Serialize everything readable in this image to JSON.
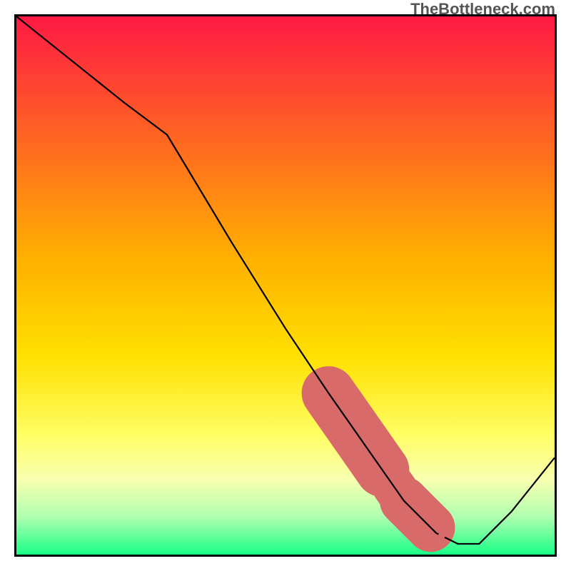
{
  "watermark": "TheBottleneck.com",
  "chart_data": {
    "type": "line",
    "title": "",
    "xlabel": "",
    "ylabel": "",
    "xlim": [
      0,
      100
    ],
    "ylim": [
      0,
      100
    ],
    "background_gradient": {
      "stops": [
        {
          "pos": 0.0,
          "color": "#ff1a44"
        },
        {
          "pos": 0.45,
          "color": "#ffb000"
        },
        {
          "pos": 0.63,
          "color": "#ffe000"
        },
        {
          "pos": 0.78,
          "color": "#ffff66"
        },
        {
          "pos": 0.86,
          "color": "#f8ffb0"
        },
        {
          "pos": 0.93,
          "color": "#b0ffb0"
        },
        {
          "pos": 1.0,
          "color": "#1aff88"
        }
      ]
    },
    "series": [
      {
        "name": "bottleneck-curve",
        "x": [
          0,
          10,
          20,
          28,
          40,
          50,
          58,
          65,
          72,
          78,
          82,
          86,
          92,
          100
        ],
        "y": [
          100,
          92,
          84,
          78,
          58,
          42,
          30,
          20,
          10,
          4,
          2,
          2,
          8,
          18
        ]
      }
    ],
    "highlight_segments": [
      {
        "name": "highlight-upper",
        "x_start": 58,
        "x_end": 68,
        "thickness": 10
      },
      {
        "name": "highlight-mid",
        "x_start": 70,
        "x_end": 71,
        "thickness": 8
      },
      {
        "name": "highlight-lower",
        "x_start": 72,
        "x_end": 77,
        "thickness": 9
      }
    ],
    "highlight_points": [
      {
        "x": 79,
        "y": 3.5,
        "r": 5
      }
    ],
    "colors": {
      "line": "#000000",
      "highlight": "#d86a6a"
    }
  }
}
